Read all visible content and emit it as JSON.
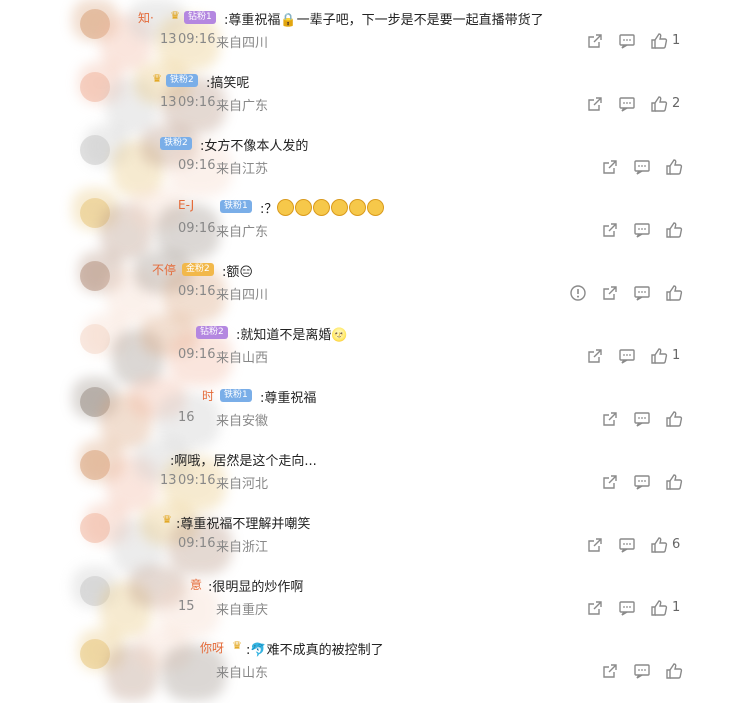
{
  "comments": [
    {
      "name": "知·",
      "badge": "钻粉1",
      "badge_type": "zuan",
      "crown": true,
      "text": ":尊重祝福🔒一辈子吧，下一步是不是要一起直播带货了",
      "date": "13",
      "time": "09:16",
      "location": "来自四川",
      "likes": "1",
      "show_share": true,
      "show_report": false
    },
    {
      "name": "",
      "badge": "铁粉2",
      "badge_type": "tie",
      "crown": true,
      "text": ":搞笑呢",
      "date": "13",
      "time": "09:16",
      "location": "来自广东",
      "likes": "2",
      "show_share": true,
      "show_report": false
    },
    {
      "name": "",
      "badge": "铁粉2",
      "badge_type": "tie",
      "crown": false,
      "text": ":女方不像本人发的",
      "date": "",
      "time": "09:16",
      "location": "来自江苏",
      "likes": "",
      "show_share": false,
      "show_report": false
    },
    {
      "name": "E-J",
      "badge": "铁粉1",
      "badge_type": "tie",
      "crown": false,
      "text": ":？",
      "emojis": 6,
      "date": "",
      "time": "09:16",
      "location": "来自广东",
      "likes": "",
      "show_share": false,
      "show_report": false
    },
    {
      "name": "不停",
      "badge": "金粉2",
      "badge_type": "jin",
      "crown": false,
      "text": ":额😑",
      "date": "",
      "time": "09:16",
      "location": "来自四川",
      "likes": "",
      "show_share": false,
      "show_report": true
    },
    {
      "name": "",
      "badge": "钻粉2",
      "badge_type": "zuan",
      "crown": false,
      "text": ":就知道不是离婚🌝",
      "date": "",
      "time": "09:16",
      "location": "来自山西",
      "likes": "1",
      "show_share": true,
      "show_report": false
    },
    {
      "name": "时",
      "badge": "铁粉1",
      "badge_type": "tie",
      "crown": false,
      "text": ":尊重祝福",
      "date": "",
      "time": "16",
      "location": "来自安徽",
      "likes": "",
      "show_share": true,
      "show_report": false
    },
    {
      "name": "",
      "badge": "",
      "badge_type": "tie",
      "crown": false,
      "text": ":啊哦，居然是这个走向...",
      "date": "13",
      "time": "09:16",
      "location": "来自河北",
      "likes": "",
      "show_share": false,
      "show_report": false
    },
    {
      "name": "",
      "badge": "",
      "badge_type": "jin",
      "crown": true,
      "text": ":尊重祝福不理解并嘲笑",
      "date": "",
      "time": "09:16",
      "location": "来自浙江",
      "likes": "6",
      "show_share": true,
      "show_report": false
    },
    {
      "name": "意",
      "badge": "",
      "badge_type": "jin",
      "crown": false,
      "text": ":很明显的炒作啊",
      "date": "",
      "time": "15",
      "location": "来自重庆",
      "likes": "1",
      "show_share": true,
      "show_report": false
    },
    {
      "name": "你呀",
      "badge": "",
      "badge_type": "jin",
      "crown": true,
      "text": ":🐬难不成真的被控制了",
      "date": "",
      "time": "",
      "location": "来自山东",
      "likes": "",
      "show_share": false,
      "show_report": false
    }
  ],
  "icons": {
    "share": "share-icon",
    "comment": "comment-icon",
    "like": "thumbs-up-icon",
    "report": "report-icon"
  },
  "colors": {
    "name": "#e46b3a",
    "meta": "#888888",
    "icon": "#8a8a8a"
  }
}
